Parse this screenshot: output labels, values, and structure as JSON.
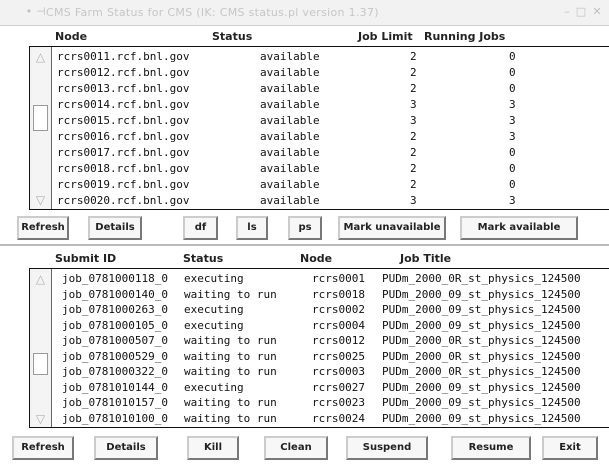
{
  "window": {
    "title": "CMS Farm Status for CMS (IK: CMS status.pl  version 1.37)"
  },
  "nodes": {
    "columns": [
      "Node",
      "Status",
      "Job Limit",
      "Running Jobs"
    ],
    "rows": [
      {
        "node": "rcrs0011.rcf.bnl.gov",
        "status": "available",
        "limit": "2",
        "running": "0"
      },
      {
        "node": "rcrs0012.rcf.bnl.gov",
        "status": "available",
        "limit": "2",
        "running": "0"
      },
      {
        "node": "rcrs0013.rcf.bnl.gov",
        "status": "available",
        "limit": "2",
        "running": "0"
      },
      {
        "node": "rcrs0014.rcf.bnl.gov",
        "status": "available",
        "limit": "3",
        "running": "3"
      },
      {
        "node": "rcrs0015.rcf.bnl.gov",
        "status": "available",
        "limit": "3",
        "running": "3"
      },
      {
        "node": "rcrs0016.rcf.bnl.gov",
        "status": "available",
        "limit": "2",
        "running": "3"
      },
      {
        "node": "rcrs0017.rcf.bnl.gov",
        "status": "available",
        "limit": "2",
        "running": "0"
      },
      {
        "node": "rcrs0018.rcf.bnl.gov",
        "status": "available",
        "limit": "2",
        "running": "0"
      },
      {
        "node": "rcrs0019.rcf.bnl.gov",
        "status": "available",
        "limit": "2",
        "running": "0"
      },
      {
        "node": "rcrs0020.rcf.bnl.gov",
        "status": "available",
        "limit": "3",
        "running": "3"
      }
    ],
    "buttons": {
      "refresh": "Refresh",
      "details": "Details",
      "df": "df",
      "ls": "ls",
      "ps": "ps",
      "mark_unavailable": "Mark unavailable",
      "mark_available": "Mark available"
    }
  },
  "jobs": {
    "columns": [
      "Submit ID",
      "Status",
      "Node",
      "Job Title"
    ],
    "rows": [
      {
        "id": "job_0781000118_0",
        "status": "executing",
        "node": "rcrs0001",
        "title": "PUDm_2000_0R_st_physics_124500"
      },
      {
        "id": "job_0781000140_0",
        "status": "waiting to run",
        "node": "rcrs0018",
        "title": "PUDm_2000_09_st_physics_124500"
      },
      {
        "id": "job_0781000263_0",
        "status": "executing",
        "node": "rcrs0002",
        "title": "PUDm_2000_09_st_physics_124500"
      },
      {
        "id": "job_0781000105_0",
        "status": "executing",
        "node": "rcrs0004",
        "title": "PUDm_2000_09_st_physics_124500"
      },
      {
        "id": "job_0781000507_0",
        "status": "waiting to run",
        "node": "rcrs0012",
        "title": "PUDm_2000_0R_st_physics_124500"
      },
      {
        "id": "job_0781000529_0",
        "status": "waiting to run",
        "node": "rcrs0025",
        "title": "PUDm_2000_0R_st_physics_124500"
      },
      {
        "id": "job_0781000322_0",
        "status": "waiting to run",
        "node": "rcrs0003",
        "title": "PUDm_2000_0R_st_physics_124500"
      },
      {
        "id": "job_0781010144_0",
        "status": "executing",
        "node": "rcrs0027",
        "title": "PUDm_2000_09_st_physics_124500"
      },
      {
        "id": "job_0781010157_0",
        "status": "waiting to run",
        "node": "rcrs0023",
        "title": "PUDm_2000_09_st_physics_124500"
      },
      {
        "id": "job_0781010100_0",
        "status": "waiting to run",
        "node": "rcrs0024",
        "title": "PUDm_2000_09_st_physics_124500"
      }
    ],
    "buttons": {
      "refresh": "Refresh",
      "details": "Details",
      "kill": "Kill",
      "clean": "Clean",
      "suspend": "Suspend",
      "resume": "Resume",
      "exit": "Exit"
    }
  },
  "icons": {
    "menu": "window-menu-icon",
    "pin": "pin-icon",
    "minimize": "minimize-icon",
    "maximize": "maximize-icon",
    "close": "close-icon",
    "scroll_up": "scroll-up-arrow-icon",
    "scroll_down": "scroll-down-arrow-icon"
  }
}
